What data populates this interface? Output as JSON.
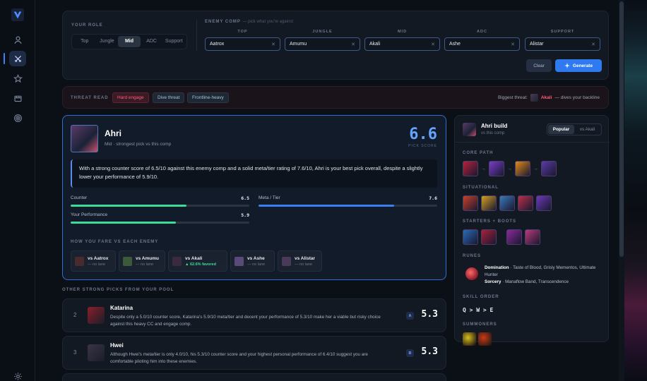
{
  "role": {
    "label": "YOUR ROLE",
    "options": [
      "Top",
      "Jungle",
      "Mid",
      "ADC",
      "Support"
    ],
    "selected": "Mid"
  },
  "enemy_comp": {
    "label": "ENEMY COMP",
    "hint": "— pick what you're against",
    "lanes": [
      {
        "lane": "TOP",
        "champion": "Aatrox"
      },
      {
        "lane": "JUNGLE",
        "champion": "Amumu"
      },
      {
        "lane": "MID",
        "champion": "Akali"
      },
      {
        "lane": "ADC",
        "champion": "Ashe"
      },
      {
        "lane": "SUPPORT",
        "champion": "Alistar"
      }
    ],
    "clear_label": "Clear",
    "generate_label": "Generate"
  },
  "threat": {
    "label": "THREAT READ",
    "tags": [
      "Hard engage",
      "Dive threat",
      "Frontline-heavy"
    ],
    "biggest_label": "Biggest threat:",
    "biggest_champ": "Akali",
    "biggest_note": "— dives your backline"
  },
  "best_pick": {
    "name": "Ahri",
    "subtitle": "Mid · strongest pick vs this comp",
    "score": "6.6",
    "score_label": "PICK SCORE",
    "blurb": "With a strong counter score of 6.5/10 against this enemy comp and a solid meta/tier rating of 7.6/10, Ahri is your best pick overall, despite a slightly lower your performance of 5.9/10.",
    "stats": [
      {
        "label": "Counter",
        "value": "6.5",
        "fraction": 0.65,
        "color": "#3ddc97"
      },
      {
        "label": "Meta / Tier",
        "value": "7.6",
        "fraction": 0.76,
        "color": "#3d7ef0"
      },
      {
        "label": "Your Performance",
        "value": "5.9",
        "fraction": 0.59,
        "color": "#3ddc97"
      }
    ],
    "fare_label": "HOW YOU FARE VS EACH ENEMY",
    "fares": [
      {
        "title": "vs Aatrox",
        "note": "— no lane",
        "color": "#4a2a2f"
      },
      {
        "title": "vs Amumu",
        "note": "— no lane",
        "color": "#3a5a3a"
      },
      {
        "title": "vs Akali",
        "note": "▲ 62.6% favored",
        "color": "#3a2a40"
      },
      {
        "title": "vs Ashe",
        "note": "— no lane",
        "color": "#5a4a7a"
      },
      {
        "title": "vs Alistar",
        "note": "— no lane",
        "color": "#4a3a5a"
      }
    ]
  },
  "others": {
    "label": "OTHER STRONG PICKS FROM YOUR POOL",
    "picks": [
      {
        "rank": "2",
        "name": "Katarina",
        "desc": "Despite only a 5.0/10 counter score, Katarina's 5.9/10 meta/tier and decent your performance of 5.3/10 make her a viable but risky choice against this heavy CC and engage comp.",
        "tier": "A",
        "score": "5.3",
        "color": "#8a1f2a"
      },
      {
        "rank": "3",
        "name": "Hwei",
        "desc": "Although Hwei's meta/tier is only 4.0/10, his 5.3/10 counter score and your highest personal performance of 6.4/10 suggest you are comfortable piloting him into these enemies.",
        "tier": "B",
        "score": "5.3",
        "color": "#3a3448"
      }
    ]
  },
  "build": {
    "title": "Ahri build",
    "subtitle": "vs this comp",
    "tabs": [
      "Popular",
      "vs Akali"
    ],
    "selected_tab": "Popular",
    "core_label": "CORE PATH",
    "core_items": [
      "#b8203a",
      "#7a3cc9",
      "#e08a1a",
      "#5a3aa8"
    ],
    "situational_label": "SITUATIONAL",
    "situational_items": [
      "#c9402a",
      "#d4a020",
      "#3a7ab8",
      "#b8304a",
      "#6a3ab8"
    ],
    "starters_label": "STARTERS + BOOTS",
    "starter_items": [
      "#2a6ab8",
      "#a8203a",
      "#8a2a9a",
      "#b83a7a"
    ],
    "runes_label": "RUNES",
    "rune_primary_name": "Domination",
    "rune_primary_list": "· Taste of Blood, Grisly Mementos, Ultimate Hunter",
    "rune_secondary_name": "Sorcery",
    "rune_secondary_list": "· Manaflow Band, Transcendence",
    "skill_label": "SKILL ORDER",
    "skill_order": "Q > W > E",
    "summoners_label": "SUMMONERS",
    "summoners": [
      "#d4c020",
      "#c93a1a"
    ]
  }
}
